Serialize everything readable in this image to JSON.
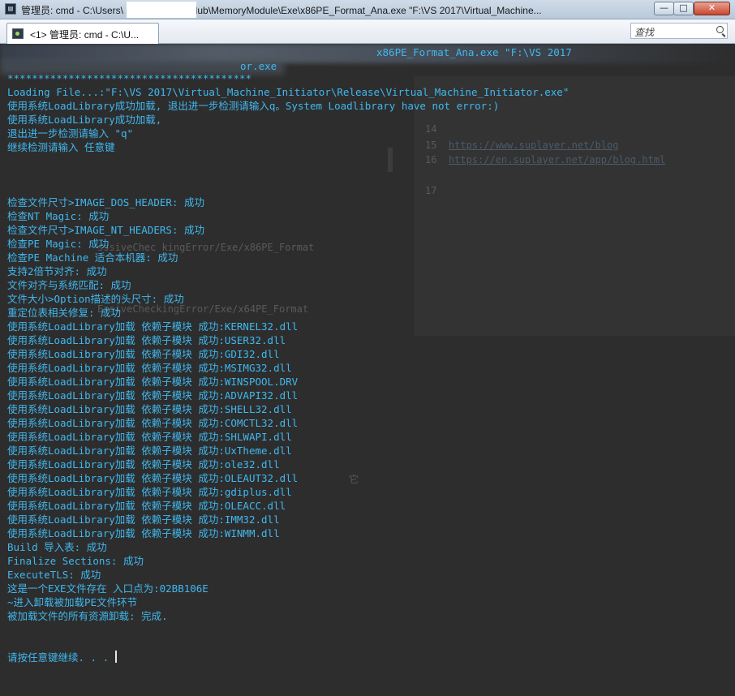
{
  "window": {
    "title": "管理员: cmd - C:\\Users\\           Documents\\GitHub\\MemoryModule\\Exe\\x86PE_Format_Ana.exe  \"F:\\VS 2017\\Virtual_Machine...",
    "icon": "console-icon",
    "minimize_label": "—",
    "maximize_label": "□",
    "close_label": "✕"
  },
  "tab": {
    "label": "<1> 管理员: cmd - C:\\U...",
    "icon": "console-tab-icon"
  },
  "search": {
    "placeholder": "查找",
    "icon": "search-icon"
  },
  "console": {
    "header_fragment": "x86PE_Format_Ana.exe \"F:\\VS 2017",
    "header_fragment2": "or.exe",
    "lines": [
      "****************************************",
      "Loading File...:\"F:\\VS 2017\\Virtual_Machine_Initiator\\Release\\Virtual_Machine_Initiator.exe\"",
      "使用系统LoadLibrary成功加载, 退出进一步检测请输入q。System Loadlibrary have not error:)",
      "使用系统LoadLibrary成功加载,",
      "退出进一步检测请输入 \"q\"",
      "继续检测请输入 任意键",
      "",
      "",
      "",
      "检查文件尺寸>IMAGE_DOS_HEADER: 成功",
      "检查NT Magic: 成功",
      "检查文件尺寸>IMAGE_NT_HEADERS: 成功",
      "检查PE Magic: 成功",
      "检查PE Machine 适合本机器: 成功",
      "支持2倍节对齐: 成功",
      "文件对齐与系统匹配: 成功",
      "文件大小>Option描述的头尺寸: 成功",
      "重定位表相关修复: 成功",
      "使用系统LoadLibrary加载 依赖子模块 成功:KERNEL32.dll",
      "使用系统LoadLibrary加载 依赖子模块 成功:USER32.dll",
      "使用系统LoadLibrary加载 依赖子模块 成功:GDI32.dll",
      "使用系统LoadLibrary加载 依赖子模块 成功:MSIMG32.dll",
      "使用系统LoadLibrary加载 依赖子模块 成功:WINSPOOL.DRV",
      "使用系统LoadLibrary加载 依赖子模块 成功:ADVAPI32.dll",
      "使用系统LoadLibrary加载 依赖子模块 成功:SHELL32.dll",
      "使用系统LoadLibrary加载 依赖子模块 成功:COMCTL32.dll",
      "使用系统LoadLibrary加载 依赖子模块 成功:SHLWAPI.dll",
      "使用系统LoadLibrary加载 依赖子模块 成功:UxTheme.dll",
      "使用系统LoadLibrary加载 依赖子模块 成功:ole32.dll",
      "使用系统LoadLibrary加载 依赖子模块 成功:OLEAUT32.dll",
      "使用系统LoadLibrary加载 依赖子模块 成功:gdiplus.dll",
      "使用系统LoadLibrary加载 依赖子模块 成功:OLEACC.dll",
      "使用系统LoadLibrary加载 依赖子模块 成功:IMM32.dll",
      "使用系统LoadLibrary加载 依赖子模块 成功:WINMM.dll",
      "Build 导入表: 成功",
      "Finalize Sections: 成功",
      "ExecuteTLS: 成功",
      "这是一个EXE文件存在 入口点为:02BB106E",
      "~进入卸载被加载PE文件环节",
      "被加载文件的所有资源卸载: 完成.",
      "",
      "",
      "请按任意键继续. . ."
    ],
    "ghost": {
      "link1": "https://www.suplayer.net/blog",
      "link2": "https://en.suplayer.net/app/blog.html",
      "path1": "sssiveChec kingError/Exe/x86PE_Format",
      "path2": "EssiveCheckingError/Exe/x64PE_Format",
      "num1": "14",
      "num2": "15",
      "num3": "16",
      "num4": "17",
      "char": "它"
    }
  },
  "colors": {
    "console_text": "#40b8ef",
    "console_bg": "#2d2d2d",
    "cursor": "#e6e6e6"
  }
}
